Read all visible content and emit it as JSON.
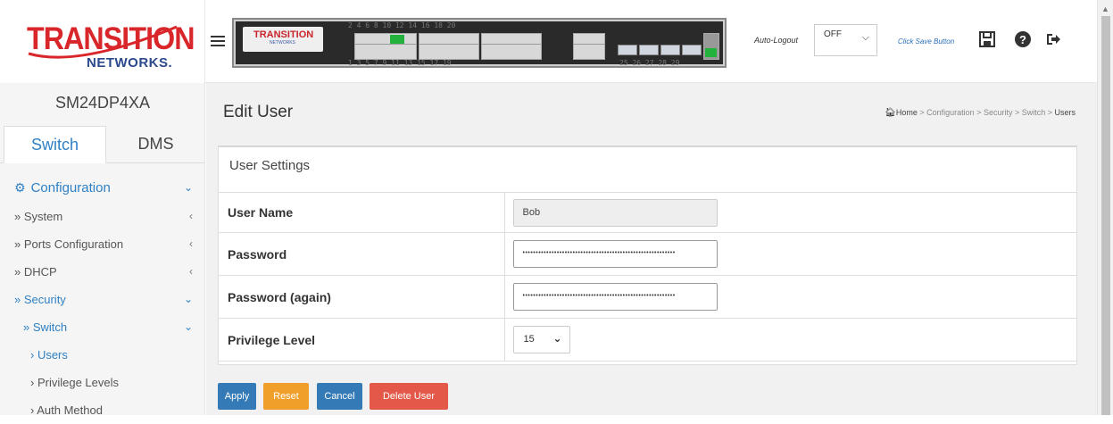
{
  "header": {
    "logo_main": "TRANSITION",
    "logo_sub": "NETWORKS.",
    "panel_logo_main": "TRANSITION",
    "panel_logo_sub": "NETWORKS",
    "port_numbers_top": "2  4  6  8   10  12  14  16   18  20",
    "port_numbers_bottom": "1  3  5  7   9  11  13  15   17  19",
    "sfp_numbers": "25   26   27   28    29",
    "auto_logout_label": "Auto-Logout",
    "auto_logout_value": "OFF",
    "save_hint": "Click Save Button",
    "icons": [
      "hamburger-icon",
      "save-icon",
      "help-icon",
      "logout-icon"
    ]
  },
  "sidebar": {
    "device_name": "SM24DP4XA",
    "tabs": [
      {
        "label": "Switch",
        "active": true
      },
      {
        "label": "DMS",
        "active": false
      }
    ],
    "nav": [
      {
        "label": "Configuration",
        "level": "head",
        "arrow": "⌄"
      },
      {
        "label": "» System",
        "level": "l1",
        "arrow": "‹"
      },
      {
        "label": "» Ports Configuration",
        "level": "l1",
        "arrow": "‹"
      },
      {
        "label": "» DHCP",
        "level": "l1",
        "arrow": "‹"
      },
      {
        "label": "» Security",
        "level": "l1",
        "arrow": "⌄"
      },
      {
        "label": "» Switch",
        "level": "l2",
        "arrow": "⌄"
      },
      {
        "label": "› Users",
        "level": "l3",
        "arrow": ""
      },
      {
        "label": "› Privilege Levels",
        "level": "l3",
        "arrow": ""
      },
      {
        "label": "› Auth Method",
        "level": "l3",
        "arrow": ""
      }
    ]
  },
  "main": {
    "title": "Edit User",
    "breadcrumb": {
      "home": "Home",
      "trail": " > Configuration > Security > Switch > ",
      "current": "Users"
    },
    "panel_title": "User Settings",
    "fields": {
      "user_name_label": "User Name",
      "user_name_value": "Bob",
      "password_label": "Password",
      "password_value": "••••••••••••••••••••••••••••••••••••••••••••••••••••••••••",
      "password_again_label": "Password (again)",
      "password_again_value": "••••••••••••••••••••••••••••••••••••••••••••••••••••••••••",
      "privilege_label": "Privilege Level",
      "privilege_value": "15"
    },
    "buttons": {
      "apply": "Apply",
      "reset": "Reset",
      "cancel": "Cancel",
      "delete": "Delete User"
    }
  },
  "colors": {
    "accent_blue": "#2f80c5",
    "apply_blue": "#347ab7",
    "reset_orange": "#f0a02a",
    "delete_red": "#e35849",
    "logo_red": "#d8262a",
    "port_green": "#23b23c"
  }
}
